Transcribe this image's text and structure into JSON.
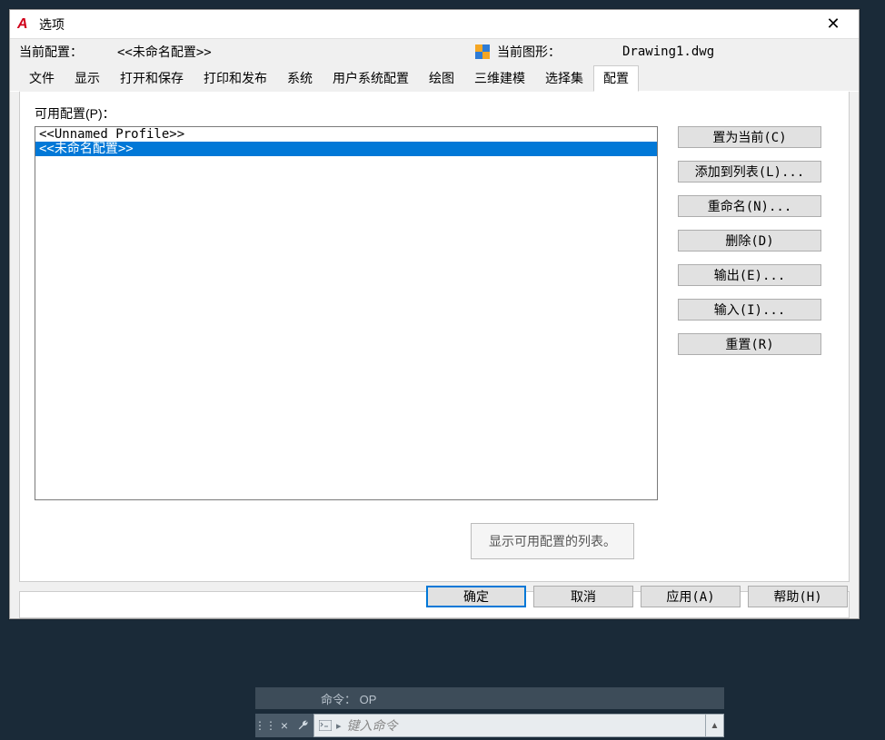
{
  "titlebar": {
    "app_letter": "A",
    "title": "选项"
  },
  "header": {
    "current_profile_label": "当前配置：",
    "current_profile_value": "<<未命名配置>>",
    "current_drawing_label": "当前图形：",
    "current_drawing_value": "Drawing1.dwg"
  },
  "tabs": [
    {
      "label": "文件"
    },
    {
      "label": "显示"
    },
    {
      "label": "打开和保存"
    },
    {
      "label": "打印和发布"
    },
    {
      "label": "系统"
    },
    {
      "label": "用户系统配置"
    },
    {
      "label": "绘图"
    },
    {
      "label": "三维建模"
    },
    {
      "label": "选择集"
    },
    {
      "label": "配置"
    }
  ],
  "active_tab_index": 9,
  "profiles": {
    "label": "可用配置(P)：",
    "items": [
      {
        "text": "<<Unnamed Profile>>"
      },
      {
        "text": "<<未命名配置>>"
      }
    ],
    "selected_index": 1
  },
  "side_buttons": {
    "set_current": "置为当前(C)",
    "add_to_list": "添加到列表(L)...",
    "rename": "重命名(N)...",
    "delete": "删除(D)",
    "export": "输出(E)...",
    "import": "输入(I)...",
    "reset": "重置(R)"
  },
  "tooltip": "显示可用配置的列表。",
  "bottom": {
    "ok": "确定",
    "cancel": "取消",
    "apply": "应用(A)",
    "help": "帮助(H)"
  },
  "command": {
    "history": "命令： OP",
    "placeholder": "键入命令"
  }
}
